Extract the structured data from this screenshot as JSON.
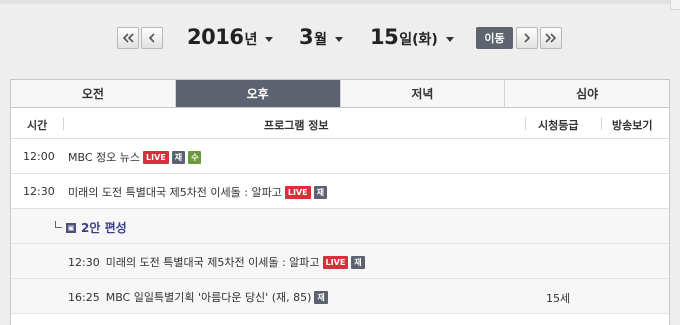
{
  "date_nav": {
    "year": "2016",
    "year_unit": "년",
    "month": "3",
    "month_unit": "월",
    "day": "15",
    "day_unit": "일(화)",
    "go_label": "이동"
  },
  "tabs": [
    {
      "label": "오전",
      "active": false
    },
    {
      "label": "오후",
      "active": true
    },
    {
      "label": "저녁",
      "active": false
    },
    {
      "label": "심야",
      "active": false
    }
  ],
  "table": {
    "headers": {
      "time": "시간",
      "program": "프로그램 정보",
      "rating": "시청등급",
      "watch": "방송보기"
    },
    "rows": [
      {
        "time": "12:00",
        "title": "MBC 정오 뉴스",
        "badges": [
          "LIVE",
          "재",
          "수"
        ],
        "rating": ""
      },
      {
        "time": "12:30",
        "title": "미래의 도전 특별대국 제5차전 이세돌 : 알파고",
        "badges": [
          "LIVE",
          "재"
        ],
        "rating": ""
      }
    ],
    "alt_schedule": {
      "label": "2안 편성",
      "rows": [
        {
          "time": "12:30",
          "title": "미래의 도전 특별대국 제5차전 이세돌 : 알파고",
          "badges": [
            "LIVE",
            "재"
          ],
          "rating": ""
        },
        {
          "time": "16:25",
          "title": "MBC 일일특별기획 '아름다운 당신' (재, 85)",
          "badges": [
            "재"
          ],
          "rating": "15세"
        }
      ]
    }
  },
  "colors": {
    "accent": "#5c6270",
    "live": "#d6303a",
    "sub": "#6a9b3a",
    "alt_label": "#3b3f8a"
  }
}
